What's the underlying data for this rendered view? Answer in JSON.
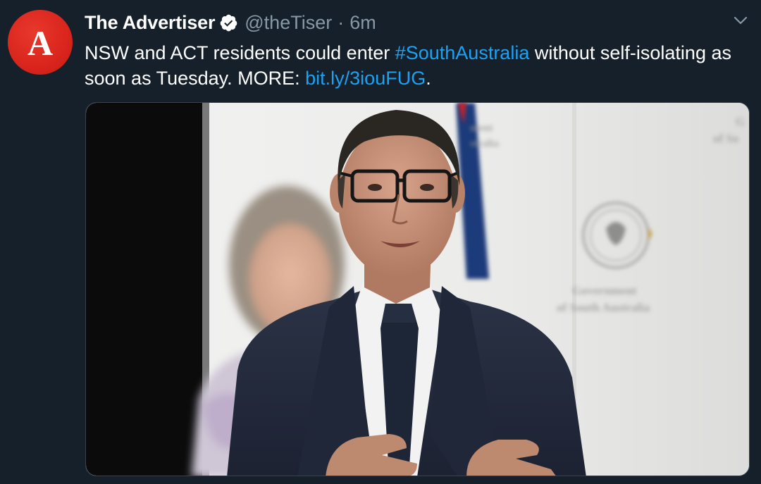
{
  "tweet": {
    "avatar_letter": "A",
    "display_name": "The Advertiser",
    "handle": "@theTiser",
    "separator": "·",
    "time": "6m",
    "text_part1": "NSW and ACT residents could enter ",
    "hashtag": "#SouthAustralia",
    "text_part2": " without self-isolating as soon as Tuesday. MORE: ",
    "link": "bit.ly/3iouFUG",
    "text_part3": "."
  },
  "media": {
    "backdrop_text_top_1": "ment",
    "backdrop_text_top_2": "stralia",
    "backdrop_text_right_1": "G",
    "backdrop_text_right_2": "of So",
    "backdrop_text_mid_1": "Government",
    "backdrop_text_mid_2": "of South Australia"
  },
  "icons": {
    "verified": "verified-badge-icon",
    "more": "chevron-down-icon"
  },
  "colors": {
    "background": "#15202b",
    "secondary_text": "#8899a6",
    "link": "#1da1f2",
    "avatar_red": "#d9251c"
  }
}
